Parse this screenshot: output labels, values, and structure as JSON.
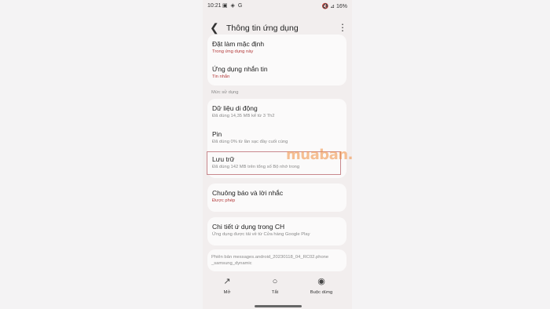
{
  "status": {
    "time": "10:21",
    "left_icons": "▣ ◈ G",
    "right": "🔇 ⊿ 16%"
  },
  "appbar": {
    "title": "Thông tin ứng dụng"
  },
  "rows": {
    "default": {
      "title": "Đặt làm mặc định",
      "sub": "Trong ứng dụng này"
    },
    "sms": {
      "title": "Ứng dụng nhắn tin",
      "sub": "Tin nhắn"
    },
    "section": "Mức sử dụng",
    "mobile_data": {
      "title": "Dữ liệu di động",
      "sub": "Đã dùng 14,35 MB kể từ 3 Th2"
    },
    "battery": {
      "title": "Pin",
      "sub": "Đã dùng 0% từ lần sạc đầy cuối cùng"
    },
    "storage": {
      "title": "Lưu trữ",
      "sub": "Đã dùng 142 MB trên tổng số Bộ nhớ trong"
    },
    "notifications": {
      "title": "Chuông báo và lời nhắc",
      "sub": "Được phép"
    },
    "store": {
      "title": "Chi tiết ứ dụng trong CH",
      "sub": "Ứng dụng được tải về từ Cửa hàng Google Play"
    }
  },
  "version": "Phiên bản messages.android_20230118_04_RC02.phone _samsung_dynamic",
  "watermark": "muaban.net",
  "bottom": {
    "open": "Mở",
    "off": "Tắt",
    "force_stop": "Buộc dừng"
  }
}
